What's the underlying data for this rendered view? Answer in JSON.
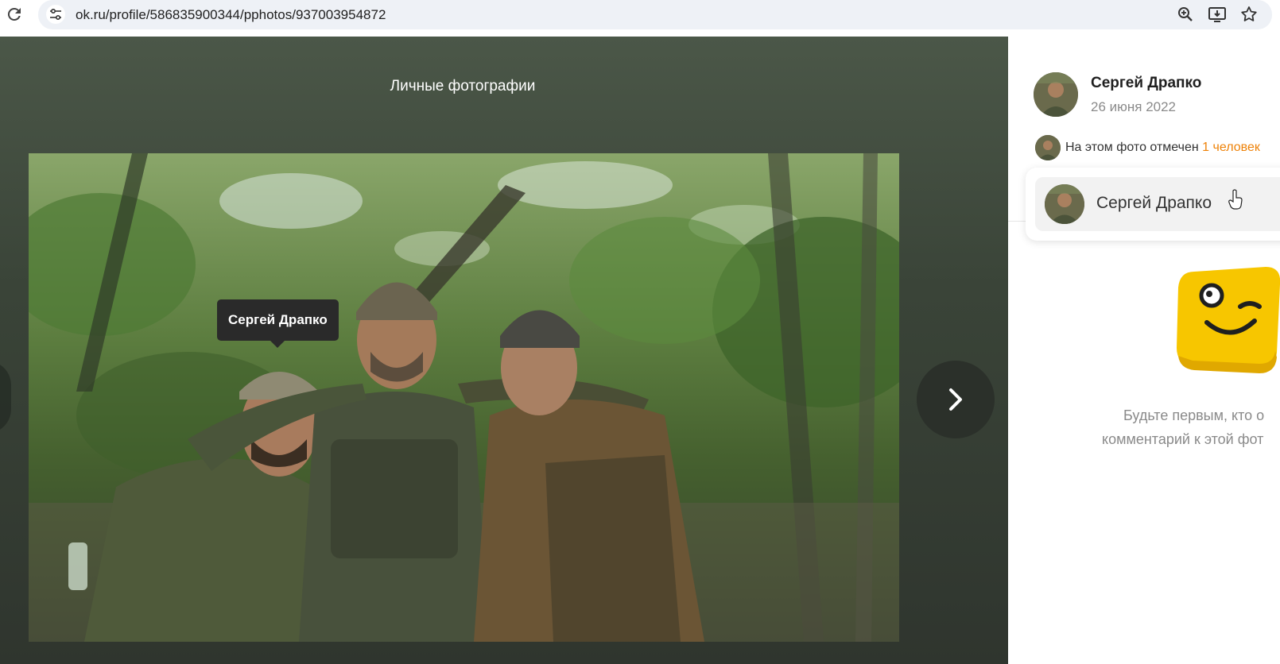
{
  "browser": {
    "url": "ok.ru/profile/586835900344/pphotos/937003954872",
    "icons": [
      "reload-icon",
      "site-settings-icon",
      "zoom-icon",
      "install-app-icon",
      "bookmark-star-icon"
    ]
  },
  "viewer": {
    "album_title": "Личные фотографии",
    "photo_tag_label": "Сергей Драпко",
    "next_icon": "chevron-right-icon"
  },
  "side": {
    "author_name": "Сергей Драпко",
    "author_date": "26 июня 2022",
    "tagged_prefix": "На этом фото отмечен",
    "tagged_link": "1 человек",
    "people": [
      {
        "name": "Сергей Драпко"
      }
    ],
    "empty_line1": "Будьте первым, кто о",
    "empty_line2": "комментарий к этой фот"
  },
  "colors": {
    "accent_link": "#ee8208",
    "mascot_yellow": "#f7c600",
    "viewer_bg": "#3a4438"
  }
}
